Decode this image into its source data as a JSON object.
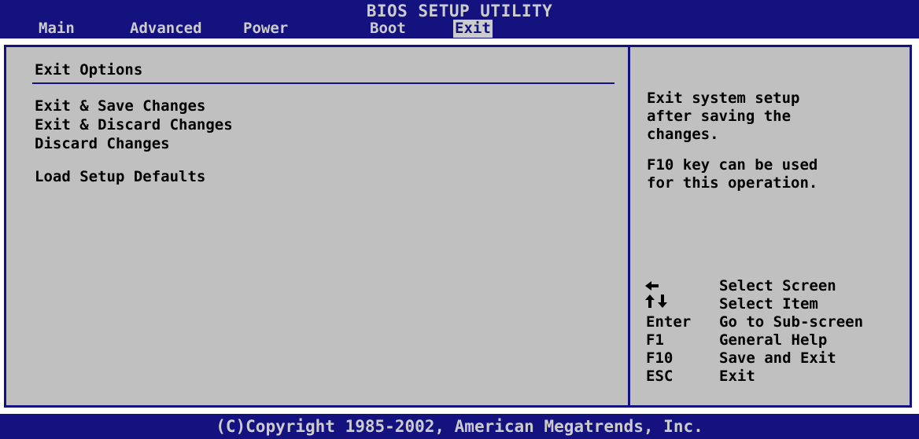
{
  "header": {
    "title": "BIOS SETUP UTILITY",
    "tabs": [
      {
        "label": "Main"
      },
      {
        "label": "Advanced"
      },
      {
        "label": "Power"
      },
      {
        "label": "Boot"
      },
      {
        "label": "Exit"
      }
    ],
    "active_tab": "Exit"
  },
  "main": {
    "section_title": "Exit Options",
    "items": [
      {
        "label": "Exit & Save Changes"
      },
      {
        "label": "Exit & Discard Changes"
      },
      {
        "label": "Discard Changes"
      },
      {
        "label": "Load Setup Defaults"
      }
    ]
  },
  "help": {
    "lines": [
      "Exit system setup",
      "after saving the",
      "changes.",
      "F10 key can be used",
      "for this operation."
    ]
  },
  "keys": [
    {
      "icon": "left-arrow-icon",
      "label": "",
      "description": "Select Screen"
    },
    {
      "icon": "up-down-arrows-icon",
      "label": "",
      "description": "Select Item"
    },
    {
      "icon": "",
      "label": "Enter",
      "description": "Go to Sub-screen"
    },
    {
      "icon": "",
      "label": "F1",
      "description": "General Help"
    },
    {
      "icon": "",
      "label": "F10",
      "description": "Save and Exit"
    },
    {
      "icon": "",
      "label": "ESC",
      "description": "Exit"
    }
  ],
  "footer": {
    "copyright": "(C)Copyright 1985-2002, American Megatrends, Inc."
  },
  "colors": {
    "bar_blue": "#14127f",
    "panel_gray": "#c0c0c0",
    "bar_text": "#cccccc"
  }
}
